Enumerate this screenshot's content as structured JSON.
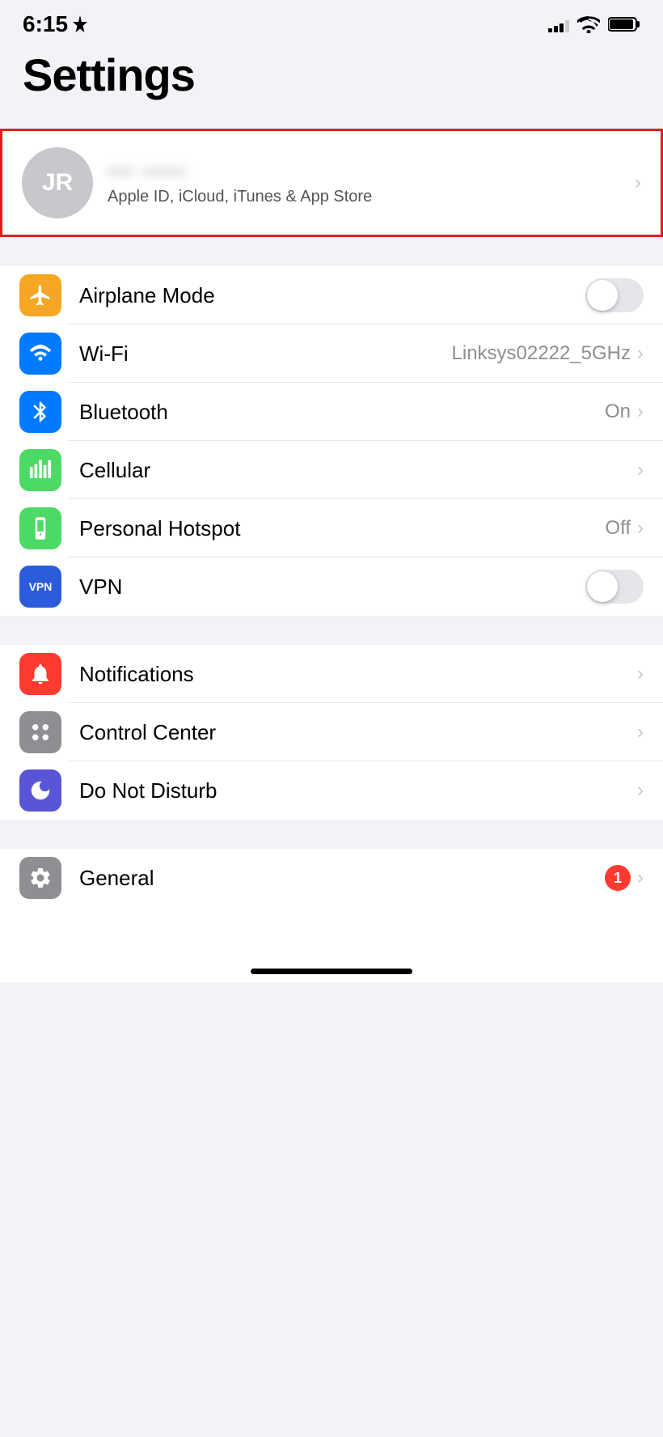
{
  "statusBar": {
    "time": "6:15",
    "locationIcon": "›",
    "signalBars": [
      3,
      5,
      8,
      11,
      14
    ],
    "batteryFull": true
  },
  "pageTitle": "Settings",
  "profile": {
    "initials": "JR",
    "namePlaceholder": "••• •••••",
    "subtitle": "Apple ID, iCloud, iTunes & App Store"
  },
  "groups": [
    {
      "id": "connectivity",
      "rows": [
        {
          "id": "airplane-mode",
          "label": "Airplane Mode",
          "iconColor": "#f5a623",
          "toggle": true,
          "toggleOn": false
        },
        {
          "id": "wifi",
          "label": "Wi-Fi",
          "iconColor": "#007aff",
          "value": "Linksys02222_5GHz",
          "chevron": true
        },
        {
          "id": "bluetooth",
          "label": "Bluetooth",
          "iconColor": "#007aff",
          "value": "On",
          "chevron": true
        },
        {
          "id": "cellular",
          "label": "Cellular",
          "iconColor": "#4cd964",
          "chevron": true
        },
        {
          "id": "personal-hotspot",
          "label": "Personal Hotspot",
          "iconColor": "#4cd964",
          "value": "Off",
          "chevron": true
        },
        {
          "id": "vpn",
          "label": "VPN",
          "iconColor": "#2c5cdb",
          "toggle": true,
          "toggleOn": false
        }
      ]
    },
    {
      "id": "system",
      "rows": [
        {
          "id": "notifications",
          "label": "Notifications",
          "iconColor": "#ff3b30",
          "chevron": true
        },
        {
          "id": "control-center",
          "label": "Control Center",
          "iconColor": "#8e8e93",
          "chevron": true
        },
        {
          "id": "do-not-disturb",
          "label": "Do Not Disturb",
          "iconColor": "#5856d6",
          "chevron": true
        }
      ]
    },
    {
      "id": "general-group",
      "rows": [
        {
          "id": "general",
          "label": "General",
          "iconColor": "#8e8e93",
          "badge": "1",
          "chevron": true
        }
      ]
    }
  ]
}
